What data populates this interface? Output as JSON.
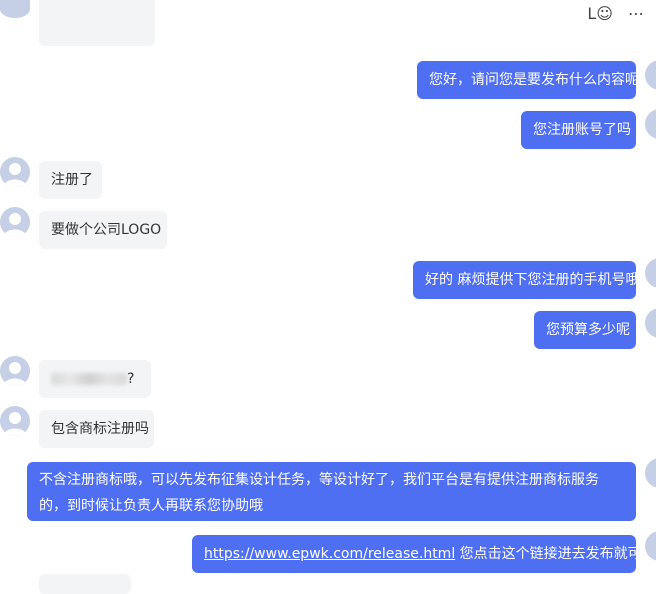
{
  "header": {
    "icon_glyph": "L☺",
    "menu_glyph": "⋯"
  },
  "messages": [
    {
      "side": "in",
      "text": ""
    },
    {
      "side": "out",
      "text": "您好，请问您是要发布什么内容呢"
    },
    {
      "side": "out",
      "text": "您注册账号了吗"
    },
    {
      "side": "in",
      "text": "注册了"
    },
    {
      "side": "in",
      "text": "要做个公司LOGO"
    },
    {
      "side": "out",
      "text": "好的 麻烦提供下您注册的手机号哦"
    },
    {
      "side": "out",
      "text": "您预算多少呢"
    },
    {
      "side": "in",
      "text": "?"
    },
    {
      "side": "in",
      "text": "包含商标注册吗"
    },
    {
      "side": "out",
      "text": "不含注册商标哦，可以先发布征集设计任务，等设计好了，我们平台是有提供注册商标服务的，到时候让负责人再联系您协助哦"
    },
    {
      "side": "out",
      "link": "https://www.epwk.com/release.html",
      "text": " 您点击这个链接进去发布就可以了"
    }
  ]
}
